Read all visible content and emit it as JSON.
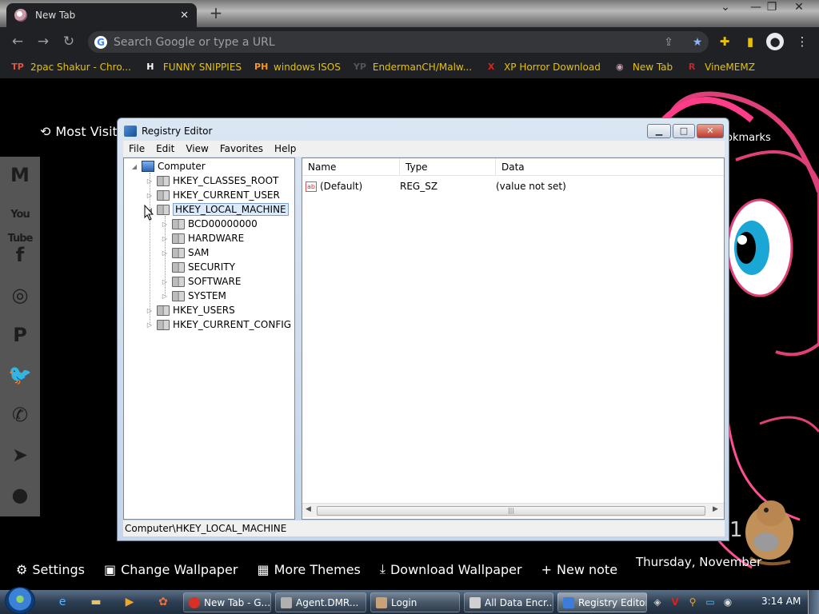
{
  "browser": {
    "tab_title": "New Tab",
    "tab_close": "✕",
    "new_tab": "+",
    "window_controls": [
      "⌄",
      "—",
      "❐",
      "✕"
    ],
    "omnibox_placeholder": "Search Google or type a URL",
    "nav": {
      "back": "←",
      "forward": "→",
      "reload": "↻"
    }
  },
  "bookmarks": [
    {
      "label": "2pac Shakur - Chro...",
      "icon": "TP",
      "color": "#e5533d"
    },
    {
      "label": "FUNNY SNIPPIES",
      "icon": "H",
      "color": "#ffffff"
    },
    {
      "label": "windows ISOS",
      "icon": "PH",
      "color": "#f7971e"
    },
    {
      "label": "EndermanCH/Malw...",
      "icon": "YP",
      "color": "#555555"
    },
    {
      "label": "XP Horror Download",
      "icon": "X",
      "color": "#e0201c"
    },
    {
      "label": "New Tab",
      "icon": "◉",
      "color": "#c9a0b4"
    },
    {
      "label": "VineMEMZ",
      "icon": "R",
      "color": "#c0272d"
    }
  ],
  "newtab_page": {
    "most_visited": "Most Visit",
    "bookmarks_label": "okmarks",
    "bottom_links": [
      {
        "icon": "⚙",
        "label": "Settings"
      },
      {
        "icon": "▣",
        "label": "Change Wallpaper"
      },
      {
        "icon": "▦",
        "label": "More Themes"
      },
      {
        "icon": "⤓",
        "label": "Download Wallpaper"
      },
      {
        "icon": "+",
        "label": "New note"
      }
    ],
    "clock_fragment": "1",
    "date": "Thursday, November",
    "social": [
      {
        "name": "gmail",
        "glyph": "M"
      },
      {
        "name": "youtube",
        "glyph": "You Tube"
      },
      {
        "name": "facebook",
        "glyph": "f"
      },
      {
        "name": "instagram",
        "glyph": "◎"
      },
      {
        "name": "pinterest",
        "glyph": "P"
      },
      {
        "name": "twitter",
        "glyph": "🐦"
      },
      {
        "name": "whatsapp",
        "glyph": "✆"
      },
      {
        "name": "telegram",
        "glyph": "➤"
      },
      {
        "name": "reddit",
        "glyph": "●"
      }
    ]
  },
  "registry": {
    "title": "Registry Editor",
    "caption_buttons": {
      "minimize": "▁",
      "maximize": "□",
      "close": "✕"
    },
    "menu": [
      "File",
      "Edit",
      "View",
      "Favorites",
      "Help"
    ],
    "tree": {
      "root": "Computer",
      "hives": [
        "HKEY_CLASSES_ROOT",
        "HKEY_CURRENT_USER",
        "HKEY_LOCAL_MACHINE",
        "HKEY_USERS",
        "HKEY_CURRENT_CONFIG"
      ],
      "hklm_children": [
        "BCD00000000",
        "HARDWARE",
        "SAM",
        "SECURITY",
        "SOFTWARE",
        "SYSTEM"
      ],
      "selected": "HKEY_LOCAL_MACHINE"
    },
    "columns": [
      "Name",
      "Type",
      "Data"
    ],
    "values": [
      {
        "name": "(Default)",
        "type": "REG_SZ",
        "data": "(value not set)",
        "icon": "ab"
      }
    ],
    "status": "Computer\\HKEY_LOCAL_MACHINE"
  },
  "taskbar": {
    "quick_launch": [
      "ie",
      "explorer",
      "media",
      "extra"
    ],
    "buttons": [
      {
        "label": "New Tab - G...",
        "color": "#d93025"
      },
      {
        "label": "Agent.DMR...",
        "color": "#b0b0b0"
      },
      {
        "label": "Login",
        "color": "#c9a27a"
      },
      {
        "label": "All Data Encr...",
        "color": "#d0d0d0"
      },
      {
        "label": "Registry Editor",
        "color": "#3b7dd8",
        "active": true
      }
    ],
    "tray": [
      "◈",
      "V",
      "⚲",
      "▭",
      "◉"
    ],
    "time": "3:14 AM"
  }
}
